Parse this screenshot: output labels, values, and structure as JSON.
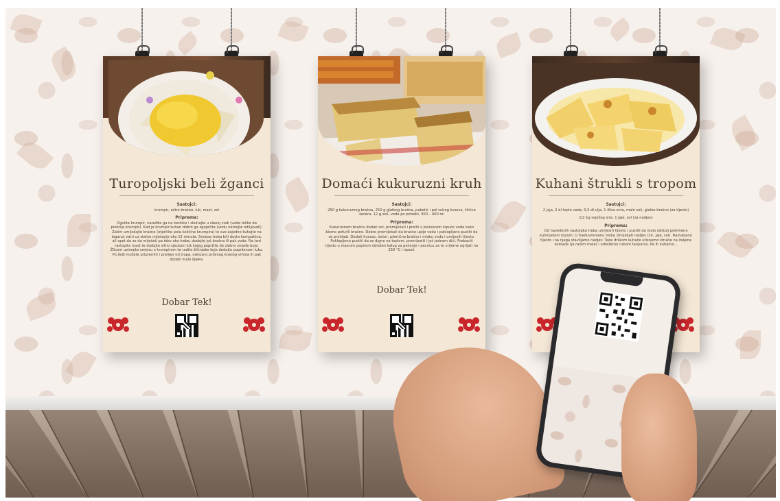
{
  "posters": [
    {
      "title": "Turopoljski beli žganci",
      "sastojci_heading": "Sastojci:",
      "sastojci": "krumpir, oštro brašno, luk, mast, sol",
      "priprema_heading": "Priprema:",
      "priprema": "Ogulite krumpir, narežite ga na kockice i skuhajte u slanoj vodi (vode toliko da prekrije krumpir). Kad je krumpir kuhan dobro ga zgnječite (vodu nemojte odlijevati). Zatim umiješajte brašno (otprilike pola količine krumpira) te sve zajedno kuhajte na laganoj vatri uz stalno miješanje oko 15 minuta. Smjesa treba biti dosta kompaktna, ali opet da se da miješati pa tako ako treba, dodajte još brašna ili pak vode. Na tavi rastopite mast te dodajte sitno sjeckani luk kojeg popržite do zlatno smeđe boje. Žlicom uzimajte smjesu s krumpirom te radite žličnjake koje dodajte popržanom luku. Po želji možete pripremiti i prelijev od tropa, odnosno prženog kiselog vrhnja ili pak dodati malo špeka.",
      "closing": "Dobar Tek!"
    },
    {
      "title": "Domaći kukuruzni kruh",
      "sastojci_heading": "Sastojci:",
      "sastojci": "250 g kukuruznog brašna, 250 g glatkog brašna, paketić i pol suhog kvasca, žličica šećera, 12 g soli, vode po potrebi, 300 – 400 ml",
      "priprema_heading": "Priprema:",
      "priprema": "Kukuruznom brašnu dodati sol, promiješati i preliti s polovicom kipuće vode kako bismo pofurili brašno. Dobro promiješati da brašno upije vodu i pokloplјeno pustiti da se prohladi. Dodati kvasac, šećer, pšenično brašno i mlaku vodu i umijesiti tijesto. Poklopljeno pustiti da se digne na toplom, promijesiti i još jednom dići. Prebaciti tijesto u masnim papirom obložen kalup za pečenje i pecnicu za to vrijeme ugrijati na 250 °C i ispeći.",
      "closing": "Dobar Tek!"
    },
    {
      "title": "Kuhani štrukli s tropom",
      "sastojci_heading": "Sastojci:",
      "sastojci": "2 jaja, 2 dl tople vode, 0,5 dl ulja, 1 žlica octa, malo soli, glatko brašno (za tijesto)",
      "sastojci2": "1/2 kg svježeg sira, 1 jaje, sol (za nadjev)",
      "priprema_heading": "Priprema:",
      "priprema": "Od navedenih sastojaka treba umijesiti tijesto i pustiti da malo odstoji pokriveno kuhinjskom krpom. U međuvremenu treba izmiješati nadjev (sir, jaje, sol). Razvaljano tijesto i na njega staviljamo nadjev. Tada drškom kuhače utisnemo štrukle na željene komade (ja radim male) i odrežemo rubom tanjurića. Pa ih kuhamo...",
      "closing": ""
    }
  ],
  "colors": {
    "poster_bg": "#f4e7d6",
    "accent_red": "#c8262b",
    "text": "#3a2e27"
  },
  "icons": [
    "qr-code-icon",
    "red-flower-ornament-icon",
    "binder-clip-icon"
  ]
}
